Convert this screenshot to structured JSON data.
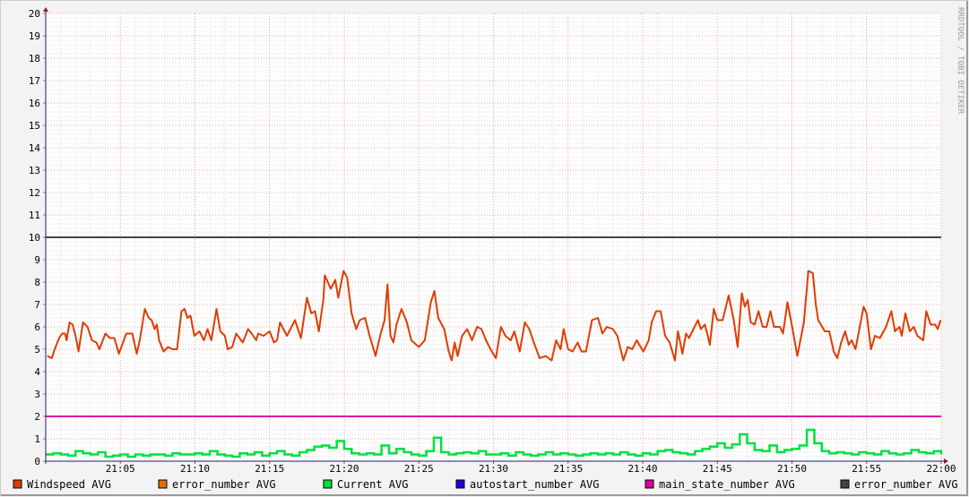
{
  "chart_data": {
    "type": "line",
    "title": "",
    "xlabel": "",
    "ylabel": "",
    "watermark": "RRDTOOL / TOBI OETIKER",
    "x_unit": "minutes after 21:00",
    "xlim": [
      0,
      60
    ],
    "ylim": [
      0,
      20
    ],
    "grid": true,
    "y_ticks": [
      0,
      1,
      2,
      3,
      4,
      5,
      6,
      7,
      8,
      9,
      10,
      11,
      12,
      13,
      14,
      15,
      16,
      17,
      18,
      19,
      20
    ],
    "x_ticks": [
      {
        "m": 5,
        "label": "21:05"
      },
      {
        "m": 10,
        "label": "21:10"
      },
      {
        "m": 15,
        "label": "21:15"
      },
      {
        "m": 20,
        "label": "21:20"
      },
      {
        "m": 25,
        "label": "21:25"
      },
      {
        "m": 30,
        "label": "21:30"
      },
      {
        "m": 35,
        "label": "21:35"
      },
      {
        "m": 40,
        "label": "21:40"
      },
      {
        "m": 45,
        "label": "21:45"
      },
      {
        "m": 50,
        "label": "21:50"
      },
      {
        "m": 55,
        "label": "21:55"
      },
      {
        "m": 60,
        "label": "22:00"
      }
    ],
    "legend": [
      {
        "label": "Windspeed AVG",
        "color": "#e03c00"
      },
      {
        "label": "error_number AVG",
        "color": "#e07000"
      },
      {
        "label": "Current AVG",
        "color": "#00e040"
      },
      {
        "label": "autostart_number AVG",
        "color": "#2000e0"
      },
      {
        "label": "main_state_number AVG",
        "color": "#e000a0"
      },
      {
        "label": "error_number AVG",
        "color": "#444444"
      }
    ],
    "series": [
      {
        "name": "Windspeed AVG",
        "color": "#e03c00",
        "points": [
          [
            0.1,
            4.7
          ],
          [
            0.4,
            4.6
          ],
          [
            0.6,
            5.0
          ],
          [
            0.9,
            5.5
          ],
          [
            1.1,
            5.7
          ],
          [
            1.3,
            5.7
          ],
          [
            1.4,
            5.4
          ],
          [
            1.6,
            6.2
          ],
          [
            1.8,
            6.1
          ],
          [
            2.0,
            5.6
          ],
          [
            2.2,
            4.9
          ],
          [
            2.5,
            6.2
          ],
          [
            2.8,
            6.0
          ],
          [
            3.1,
            5.4
          ],
          [
            3.4,
            5.3
          ],
          [
            3.6,
            5.0
          ],
          [
            4.0,
            5.7
          ],
          [
            4.3,
            5.5
          ],
          [
            4.6,
            5.5
          ],
          [
            4.9,
            4.8
          ],
          [
            5.4,
            5.7
          ],
          [
            5.8,
            5.7
          ],
          [
            6.1,
            4.8
          ],
          [
            6.3,
            5.4
          ],
          [
            6.64,
            6.8
          ],
          [
            6.9,
            6.4
          ],
          [
            7.1,
            6.3
          ],
          [
            7.3,
            5.9
          ],
          [
            7.44,
            6.1
          ],
          [
            7.6,
            5.4
          ],
          [
            7.9,
            4.9
          ],
          [
            8.2,
            5.1
          ],
          [
            8.5,
            5.0
          ],
          [
            8.8,
            5.0
          ],
          [
            9.1,
            6.7
          ],
          [
            9.3,
            6.8
          ],
          [
            9.5,
            6.4
          ],
          [
            9.7,
            6.5
          ],
          [
            9.96,
            5.6
          ],
          [
            10.3,
            5.8
          ],
          [
            10.6,
            5.4
          ],
          [
            10.84,
            5.9
          ],
          [
            11.1,
            5.4
          ],
          [
            11.44,
            6.8
          ],
          [
            11.7,
            5.8
          ],
          [
            12.0,
            5.6
          ],
          [
            12.2,
            5.0
          ],
          [
            12.5,
            5.1
          ],
          [
            12.76,
            5.7
          ],
          [
            13.2,
            5.3
          ],
          [
            13.56,
            5.9
          ],
          [
            13.8,
            5.7
          ],
          [
            14.1,
            5.4
          ],
          [
            14.24,
            5.7
          ],
          [
            14.6,
            5.6
          ],
          [
            15.0,
            5.8
          ],
          [
            15.3,
            5.3
          ],
          [
            15.5,
            5.4
          ],
          [
            15.7,
            6.2
          ],
          [
            16.16,
            5.6
          ],
          [
            16.7,
            6.3
          ],
          [
            17.1,
            5.5
          ],
          [
            17.5,
            7.3
          ],
          [
            17.8,
            6.6
          ],
          [
            18.04,
            6.7
          ],
          [
            18.3,
            5.8
          ],
          [
            18.6,
            7.2
          ],
          [
            18.7,
            8.3
          ],
          [
            19.1,
            7.7
          ],
          [
            19.4,
            8.1
          ],
          [
            19.6,
            7.3
          ],
          [
            19.96,
            8.5
          ],
          [
            20.2,
            8.2
          ],
          [
            20.5,
            6.6
          ],
          [
            20.8,
            5.9
          ],
          [
            21.04,
            6.3
          ],
          [
            21.4,
            6.4
          ],
          [
            21.7,
            5.6
          ],
          [
            22.1,
            4.7
          ],
          [
            22.4,
            5.6
          ],
          [
            22.7,
            6.3
          ],
          [
            22.9,
            7.9
          ],
          [
            23.1,
            5.6
          ],
          [
            23.3,
            5.3
          ],
          [
            23.5,
            6.1
          ],
          [
            23.84,
            6.8
          ],
          [
            24.2,
            6.2
          ],
          [
            24.5,
            5.4
          ],
          [
            25.0,
            5.1
          ],
          [
            25.4,
            5.4
          ],
          [
            25.8,
            7.1
          ],
          [
            26.04,
            7.6
          ],
          [
            26.3,
            6.4
          ],
          [
            26.7,
            5.9
          ],
          [
            27.0,
            4.9
          ],
          [
            27.2,
            4.5
          ],
          [
            27.4,
            5.3
          ],
          [
            27.6,
            4.7
          ],
          [
            27.9,
            5.6
          ],
          [
            28.24,
            5.9
          ],
          [
            28.56,
            5.4
          ],
          [
            28.9,
            6.0
          ],
          [
            29.2,
            5.9
          ],
          [
            29.5,
            5.4
          ],
          [
            29.8,
            5.0
          ],
          [
            30.16,
            4.6
          ],
          [
            30.5,
            6.0
          ],
          [
            30.8,
            5.6
          ],
          [
            31.16,
            5.4
          ],
          [
            31.4,
            5.8
          ],
          [
            31.76,
            4.9
          ],
          [
            32.1,
            6.2
          ],
          [
            32.4,
            5.9
          ],
          [
            32.7,
            5.3
          ],
          [
            33.1,
            4.6
          ],
          [
            33.5,
            4.7
          ],
          [
            33.9,
            4.5
          ],
          [
            34.2,
            5.4
          ],
          [
            34.5,
            5.0
          ],
          [
            34.7,
            5.9
          ],
          [
            35.0,
            5.0
          ],
          [
            35.3,
            4.9
          ],
          [
            35.64,
            5.3
          ],
          [
            35.9,
            4.9
          ],
          [
            36.2,
            4.9
          ],
          [
            36.6,
            6.3
          ],
          [
            37.0,
            6.4
          ],
          [
            37.3,
            5.7
          ],
          [
            37.6,
            6.0
          ],
          [
            38.0,
            5.9
          ],
          [
            38.3,
            5.6
          ],
          [
            38.7,
            4.5
          ],
          [
            39.0,
            5.1
          ],
          [
            39.3,
            5.0
          ],
          [
            39.6,
            5.4
          ],
          [
            40.04,
            4.9
          ],
          [
            40.4,
            5.4
          ],
          [
            40.6,
            6.2
          ],
          [
            40.9,
            6.7
          ],
          [
            41.2,
            6.7
          ],
          [
            41.5,
            5.6
          ],
          [
            41.8,
            5.3
          ],
          [
            42.16,
            4.5
          ],
          [
            42.36,
            5.8
          ],
          [
            42.66,
            4.8
          ],
          [
            42.9,
            5.7
          ],
          [
            43.1,
            5.5
          ],
          [
            43.4,
            5.9
          ],
          [
            43.7,
            6.3
          ],
          [
            43.9,
            5.9
          ],
          [
            44.16,
            6.1
          ],
          [
            44.36,
            5.6
          ],
          [
            44.5,
            5.2
          ],
          [
            44.76,
            6.8
          ],
          [
            45.0,
            6.3
          ],
          [
            45.36,
            6.3
          ],
          [
            45.76,
            7.4
          ],
          [
            46.1,
            6.3
          ],
          [
            46.36,
            5.1
          ],
          [
            46.64,
            7.5
          ],
          [
            46.84,
            6.9
          ],
          [
            47.04,
            7.2
          ],
          [
            47.24,
            6.2
          ],
          [
            47.5,
            6.1
          ],
          [
            47.76,
            6.7
          ],
          [
            48.04,
            6.0
          ],
          [
            48.3,
            6.0
          ],
          [
            48.56,
            6.7
          ],
          [
            48.8,
            6.0
          ],
          [
            49.2,
            6.0
          ],
          [
            49.4,
            5.7
          ],
          [
            49.7,
            7.1
          ],
          [
            49.96,
            6.2
          ],
          [
            50.36,
            4.7
          ],
          [
            50.8,
            6.2
          ],
          [
            51.1,
            8.5
          ],
          [
            51.4,
            8.4
          ],
          [
            51.6,
            7.0
          ],
          [
            51.76,
            6.3
          ],
          [
            52.2,
            5.8
          ],
          [
            52.5,
            5.8
          ],
          [
            52.8,
            4.9
          ],
          [
            53.04,
            4.6
          ],
          [
            53.3,
            5.3
          ],
          [
            53.56,
            5.8
          ],
          [
            53.8,
            5.2
          ],
          [
            54.0,
            5.4
          ],
          [
            54.26,
            5.0
          ],
          [
            54.6,
            6.2
          ],
          [
            54.8,
            6.9
          ],
          [
            55.0,
            6.6
          ],
          [
            55.3,
            5.0
          ],
          [
            55.56,
            5.6
          ],
          [
            55.9,
            5.5
          ],
          [
            56.3,
            6.0
          ],
          [
            56.66,
            6.7
          ],
          [
            56.9,
            5.8
          ],
          [
            57.2,
            6.0
          ],
          [
            57.36,
            5.6
          ],
          [
            57.6,
            6.6
          ],
          [
            57.9,
            5.8
          ],
          [
            58.16,
            6.0
          ],
          [
            58.4,
            5.6
          ],
          [
            58.8,
            5.4
          ],
          [
            59.0,
            6.7
          ],
          [
            59.3,
            6.1
          ],
          [
            59.6,
            6.1
          ],
          [
            59.76,
            5.9
          ],
          [
            59.96,
            6.3
          ]
        ]
      },
      {
        "name": "Current AVG",
        "color": "#00e040",
        "step_minutes": 0.5,
        "values": [
          0.3,
          0.35,
          0.3,
          0.25,
          0.45,
          0.35,
          0.3,
          0.4,
          0.2,
          0.25,
          0.3,
          0.2,
          0.3,
          0.25,
          0.3,
          0.3,
          0.25,
          0.35,
          0.3,
          0.3,
          0.35,
          0.3,
          0.45,
          0.3,
          0.25,
          0.2,
          0.35,
          0.3,
          0.4,
          0.25,
          0.35,
          0.45,
          0.3,
          0.25,
          0.4,
          0.5,
          0.65,
          0.7,
          0.6,
          0.9,
          0.55,
          0.35,
          0.3,
          0.35,
          0.3,
          0.7,
          0.35,
          0.55,
          0.4,
          0.3,
          0.25,
          0.45,
          1.05,
          0.4,
          0.3,
          0.35,
          0.4,
          0.35,
          0.45,
          0.3,
          0.3,
          0.35,
          0.25,
          0.4,
          0.3,
          0.25,
          0.3,
          0.4,
          0.3,
          0.35,
          0.3,
          0.25,
          0.3,
          0.35,
          0.3,
          0.35,
          0.3,
          0.4,
          0.3,
          0.25,
          0.35,
          0.3,
          0.45,
          0.5,
          0.4,
          0.35,
          0.3,
          0.45,
          0.55,
          0.65,
          0.8,
          0.6,
          0.75,
          1.2,
          0.8,
          0.5,
          0.45,
          0.7,
          0.4,
          0.5,
          0.55,
          0.7,
          1.4,
          0.8,
          0.45,
          0.35,
          0.4,
          0.35,
          0.3,
          0.4,
          0.35,
          0.3,
          0.45,
          0.35,
          0.3,
          0.35,
          0.5,
          0.4,
          0.35,
          0.45,
          0.3
        ]
      },
      {
        "name": "main_state_number AVG",
        "color": "#e000a0",
        "constant": 2
      },
      {
        "name": "error_number AVG",
        "color": "#444444",
        "constant": 10
      }
    ]
  }
}
